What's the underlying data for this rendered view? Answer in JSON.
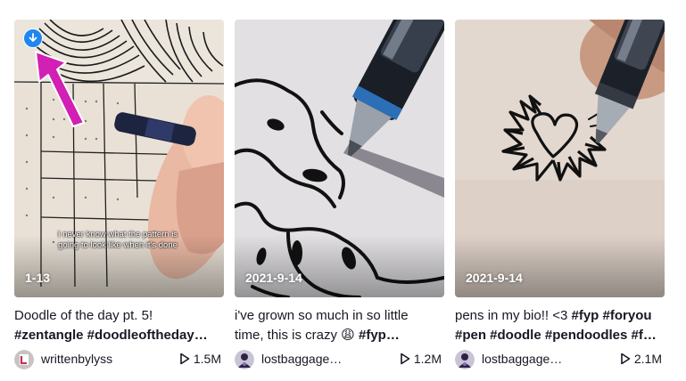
{
  "videos": [
    {
      "date": "1-13",
      "overlay_caption": "I never know what the pattern is going to look like when it's done",
      "desc_text": "Doodle of the day pt. 5!",
      "desc_tags": "#zentangle #doodleoftheday…",
      "author": "writtenbylyss",
      "views": "1.5M",
      "download_icon": "download-circle-icon",
      "annotation": "magenta-arrow"
    },
    {
      "date": "2021-9-14",
      "desc_text": "i've grown so much in so little time, this is crazy 😩 ",
      "desc_tags": "#fyp…",
      "author": "lostbaggage…",
      "views": "1.2M"
    },
    {
      "date": "2021-9-14",
      "desc_text": "pens in my bio!! <3 ",
      "desc_tags": "#fyp #foryou #pen #doodle #pendoodles #f…",
      "author": "lostbaggage…",
      "views": "2.1M"
    }
  ],
  "colors": {
    "text": "#161823",
    "download_badge": "#1f86f0",
    "annotation_arrow": "#d21fb4"
  },
  "icons": {
    "views": "play-outline-icon"
  }
}
